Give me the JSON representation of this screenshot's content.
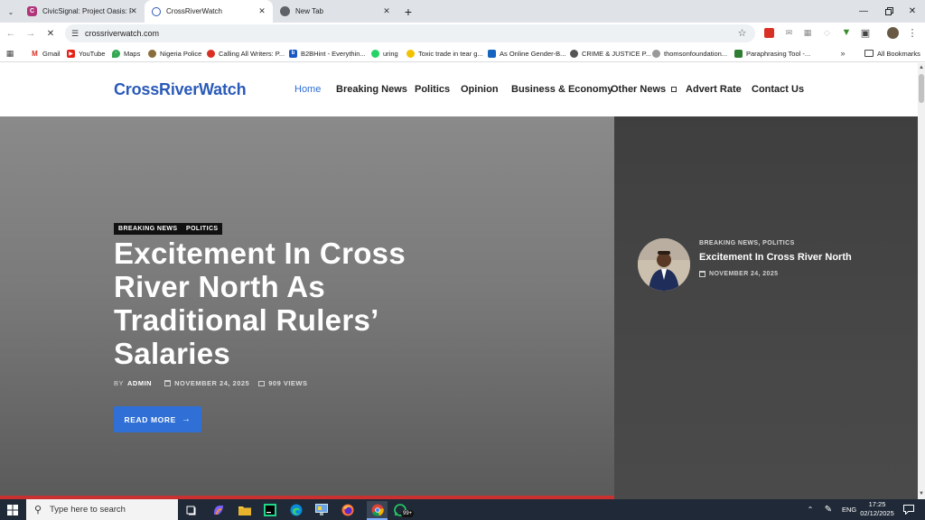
{
  "browser": {
    "tabs": [
      {
        "title": "CivicSignal: Project Oasis: Proje",
        "active": false
      },
      {
        "title": "CrossRiverWatch",
        "active": true
      },
      {
        "title": "New Tab",
        "active": false
      }
    ],
    "url": "crossriverwatch.com",
    "bookmarks": [
      "Gmail",
      "YouTube",
      "Maps",
      "Nigeria Police",
      "Calling All Writers: P...",
      "B2BHint - Everythin...",
      "uring",
      "Toxic trade in tear g...",
      "As Online Gender-B...",
      "CRIME & JUSTICE P...",
      "thomsonfoundation...",
      "Paraphrasing Tool -..."
    ],
    "all_bookmarks": "All Bookmarks"
  },
  "site": {
    "logo": "CrossRiverWatch",
    "nav": [
      "Home",
      "Breaking News",
      "Politics",
      "Opinion",
      "Business & Economy",
      "Other News",
      "Advert Rate",
      "Contact Us"
    ]
  },
  "hero": {
    "categories": [
      "BREAKING NEWS",
      "POLITICS"
    ],
    "headline": "Excitement In Cross River North As Traditional Rulers’ Salaries",
    "by_label": "BY",
    "author": "ADMIN",
    "date": "NOVEMBER 24, 2025",
    "views": "909 VIEWS",
    "read_more": "READ MORE"
  },
  "sidebar_post": {
    "categories": "BREAKING NEWS, POLITICS",
    "title": "Excitement In Cross River North",
    "date": "NOVEMBER 24, 2025"
  },
  "taskbar": {
    "search_placeholder": "Type here to search",
    "badge": "99+",
    "lang": "ENG",
    "time": "17:25",
    "date": "02/12/2025"
  },
  "colors": {
    "accent": "#2f6fd6",
    "logo": "#2a5ab8",
    "nav_active": "#2f6fd6"
  }
}
